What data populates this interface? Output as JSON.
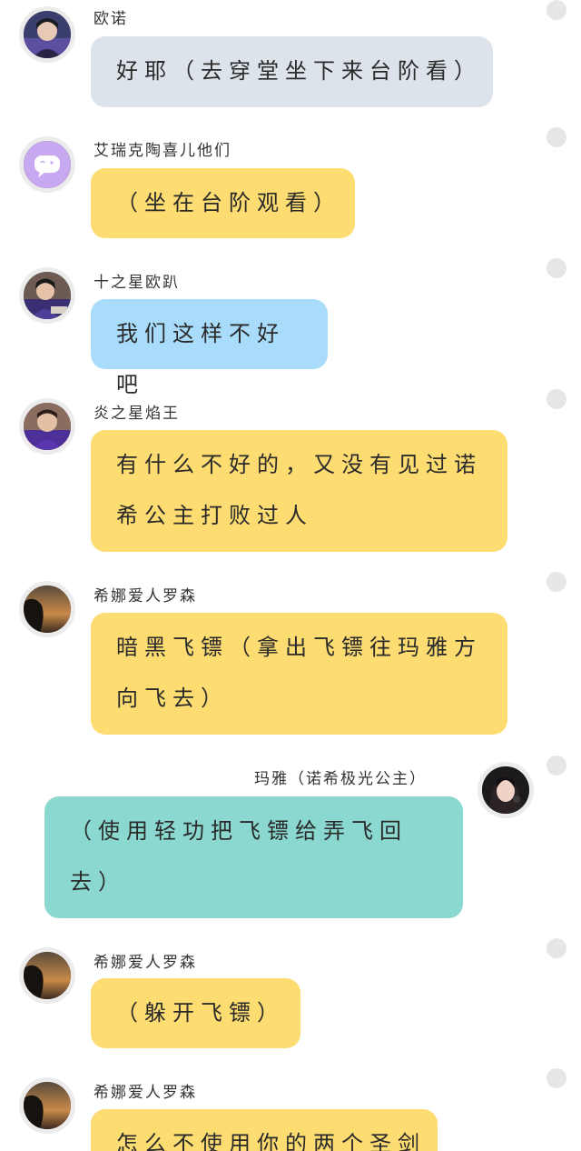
{
  "colors": {
    "grey_bubble": "#dde3ea",
    "yellow_bubble": "#fddc72",
    "blue_bubble": "#a9dcfa",
    "teal_bubble": "#8ad8cf",
    "select_circle": "#e6e6e6"
  },
  "messages": [
    {
      "sender": "欧诺",
      "text": "好耶（去穿堂坐下来台阶看）",
      "avatar_icon": "person-photo-icon",
      "bubble_color": "grey"
    },
    {
      "sender": "艾瑞克陶喜儿他们",
      "text": "（坐在台阶观看）",
      "avatar_icon": "chat-bubble-icon",
      "bubble_color": "yellow"
    },
    {
      "sender": "十之星欧趴",
      "text": "我们这样不好吧",
      "avatar_icon": "person-photo-icon",
      "bubble_color": "blue"
    },
    {
      "sender": "炎之星焰王",
      "text": "有什么不好的，又没有见过诺希公主打败过人",
      "avatar_icon": "person-photo-icon",
      "bubble_color": "yellow"
    },
    {
      "sender": "希娜爱人罗森",
      "text": "暗黑飞镖（拿出飞镖往玛雅方向飞去）",
      "avatar_icon": "silhouette-sunset-icon",
      "bubble_color": "yellow"
    },
    {
      "sender": "玛雅（诺希极光公主）",
      "text": "（使用轻功把飞镖给弄飞回去）",
      "avatar_icon": "person-photo-icon",
      "bubble_color": "teal"
    },
    {
      "sender": "希娜爱人罗森",
      "text": "（躲开飞镖）",
      "avatar_icon": "silhouette-sunset-icon",
      "bubble_color": "yellow"
    },
    {
      "sender": "希娜爱人罗森",
      "text": "怎么不使用你的两个圣剑",
      "avatar_icon": "silhouette-sunset-icon",
      "bubble_color": "yellow"
    }
  ]
}
